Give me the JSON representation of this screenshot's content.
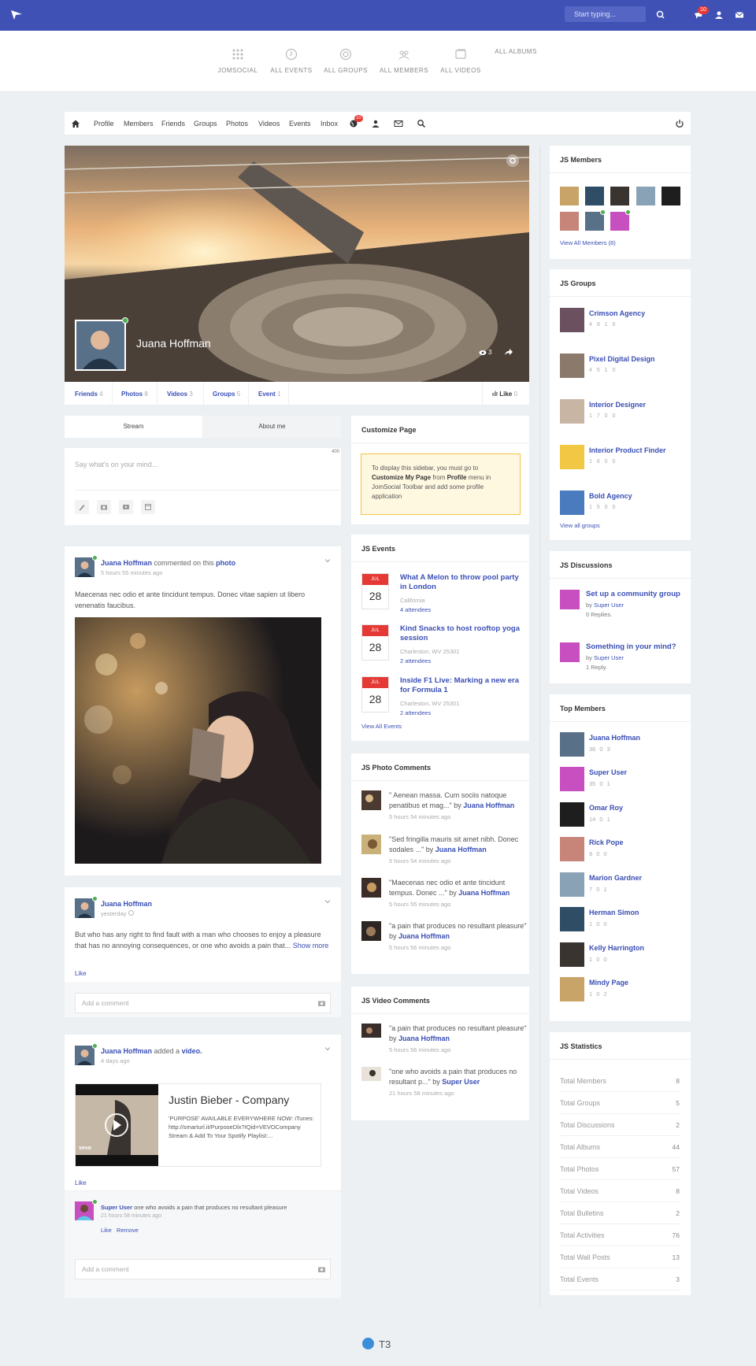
{
  "topbar": {
    "search_placeholder": "Start typing...",
    "notif_count": "10",
    "bg": "#3f51b5"
  },
  "subnav": [
    {
      "label": "JOMSOCIAL",
      "icon": "grid-icon"
    },
    {
      "label": "ALL EVENTS",
      "icon": "clock-icon"
    },
    {
      "label": "ALL GROUPS",
      "icon": "target-icon"
    },
    {
      "label": "ALL MEMBERS",
      "icon": "users-icon"
    },
    {
      "label": "ALL VIDEOS",
      "icon": "video-icon"
    },
    {
      "label": "ALL ALBUMS",
      "icon": "albums-icon"
    }
  ],
  "mainnav": {
    "items": [
      "Profile",
      "Members",
      "Friends",
      "Groups",
      "Photos",
      "Videos",
      "Events",
      "Inbox"
    ],
    "badge": "10"
  },
  "profile": {
    "name": "Juana Hoffman",
    "views": "3",
    "tabs": [
      {
        "label": "Friends",
        "count": "4"
      },
      {
        "label": "Photos",
        "count": "8"
      },
      {
        "label": "Videos",
        "count": "3"
      },
      {
        "label": "Groups",
        "count": "5"
      },
      {
        "label": "Event",
        "count": "1"
      }
    ],
    "like_label": "Like",
    "like_count": "0"
  },
  "stream": {
    "tabs": [
      "Stream",
      "About me"
    ],
    "composer_placeholder": "Say what's on your mind...",
    "char_count": "400"
  },
  "posts": [
    {
      "author": "Juana Hoffman",
      "action": "commented on this",
      "target": "photo",
      "time": "5 hours 55 minutes ago",
      "text": "Maecenas nec odio et ante tincidunt tempus. Donec vitae sapien ut libero venenatis faucibus."
    },
    {
      "author": "Juana Hoffman",
      "time": "yesterday",
      "text": "But who has any right to find fault with a man who chooses to enjoy a pleasure that has no annoying consequences, or one who avoids a pain that...",
      "show_more": "Show more",
      "like": "Like",
      "comment_placeholder": "Add a comment"
    },
    {
      "author": "Juana Hoffman",
      "action": "added a",
      "target": "video.",
      "time": "4 days ago",
      "video_title": "Justin Bieber - Company",
      "video_desc": "'PURPOSE' AVAILABLE EVERYWHERE NOW: iTunes: http://smarturl.it/PurposeDlx?IQid=VEVOCompany Stream & Add To Your Spotify Playlist:...",
      "video_brand": "vevo",
      "like": "Like",
      "comment_author": "Super User",
      "comment_text": "one who avoids a pain that produces no resultant pleasure",
      "comment_time": "21 hours 58 minutes ago",
      "comment_like": "Like",
      "comment_remove": "Remove",
      "comment_placeholder": "Add a comment"
    }
  ],
  "customize": {
    "title": "Customize Page",
    "n1": "To display this sidebar, you must go to ",
    "b1": "Customize My Page",
    "n2": " from ",
    "b2": "Profile",
    "n3": " menu in JomSocial Toolbar and add some profile application"
  },
  "events": {
    "title": "JS Events",
    "items": [
      {
        "month": "JUL",
        "day": "28",
        "title": "What A Melon to throw pool party in London",
        "location": "California",
        "attendees": "4 attendees"
      },
      {
        "month": "JUL",
        "day": "28",
        "title": "Kind Snacks to host rooftop yoga session",
        "location": "Charleston, WV 25301",
        "attendees": "2 attendees"
      },
      {
        "month": "JUL",
        "day": "28",
        "title": "Inside F1 Live: Marking a new era for Formula 1",
        "location": "Charleston, WV 25301",
        "attendees": "2 attendees"
      }
    ],
    "view_all": "View All Events"
  },
  "photo_comments": {
    "title": "JS Photo Comments",
    "by": "by",
    "items": [
      {
        "text": "\" Aenean massa. Cum sociis natoque penatibus et mag...\"",
        "author": "Juana Hoffman",
        "time": "5 hours 54 minutes ago"
      },
      {
        "text": "\"Sed fringilla mauris sit amet nibh. Donec sodales ...\"",
        "author": "Juana Hoffman",
        "time": "5 hours 54 minutes ago"
      },
      {
        "text": "\"Maecenas nec odio et ante tincidunt tempus. Donec ...\"",
        "author": "Juana Hoffman",
        "time": "5 hours 55 minutes ago"
      },
      {
        "text": "\"a pain that produces no resultant pleasure\"",
        "author": "Juana Hoffman",
        "time": "5 hours 56 minutes ago"
      }
    ]
  },
  "video_comments": {
    "title": "JS Video Comments",
    "by": "by",
    "items": [
      {
        "text": "\"a pain that produces no resultant pleasure\"",
        "author": "Juana Hoffman",
        "time": "5 hours 56 minutes ago"
      },
      {
        "text": "\"one who avoids a pain that produces no resultant p...\"",
        "author": "Super User",
        "time": "21 hours 58 minutes ago"
      }
    ]
  },
  "members": {
    "title": "JS Members",
    "view_all": "View All Members (8)"
  },
  "groups": {
    "title": "JS Groups",
    "items": [
      {
        "name": "Crimson Agency",
        "stats": "4 9 1 0"
      },
      {
        "name": "Pixel Digital Design",
        "stats": "4 5 1 0"
      },
      {
        "name": "Interior Designer",
        "stats": "1 7 0 0"
      },
      {
        "name": "Interior Product Finder",
        "stats": "1 6 0 0"
      },
      {
        "name": "Bold Agency",
        "stats": "1 5 0 0"
      }
    ],
    "view_all": "View all groups"
  },
  "discussions": {
    "title": "JS Discussions",
    "by": "by",
    "items": [
      {
        "title": "Set up a community group",
        "author": "Super User",
        "replies": "0 Replies."
      },
      {
        "title": "Something in your mind?",
        "author": "Super User",
        "replies": "1 Reply."
      }
    ]
  },
  "top_members": {
    "title": "Top Members",
    "items": [
      {
        "name": "Juana Hoffman",
        "stats": "36 0 3"
      },
      {
        "name": "Super User",
        "stats": "35 0 1"
      },
      {
        "name": "Omar Roy",
        "stats": "14 0 1"
      },
      {
        "name": "Rick Pope",
        "stats": "9 0 0"
      },
      {
        "name": "Marion Gardner",
        "stats": "7 0 1"
      },
      {
        "name": "Herman Simon",
        "stats": "1 0 0"
      },
      {
        "name": "Kelly Harrington",
        "stats": "1 0 0"
      },
      {
        "name": "Mindy Page",
        "stats": "1 0 2"
      }
    ]
  },
  "statistics": {
    "title": "JS Statistics",
    "items": [
      {
        "label": "Total Members",
        "value": "8"
      },
      {
        "label": "Total Groups",
        "value": "5"
      },
      {
        "label": "Total Discussions",
        "value": "2"
      },
      {
        "label": "Total Albums",
        "value": "44"
      },
      {
        "label": "Total Photos",
        "value": "57"
      },
      {
        "label": "Total Videos",
        "value": "8"
      },
      {
        "label": "Total Bulletins",
        "value": "2"
      },
      {
        "label": "Total Activities",
        "value": "76"
      },
      {
        "label": "Total Wall Posts",
        "value": "13"
      },
      {
        "label": "Total Events",
        "value": "3"
      }
    ]
  },
  "footer": {
    "brand": "T3"
  }
}
